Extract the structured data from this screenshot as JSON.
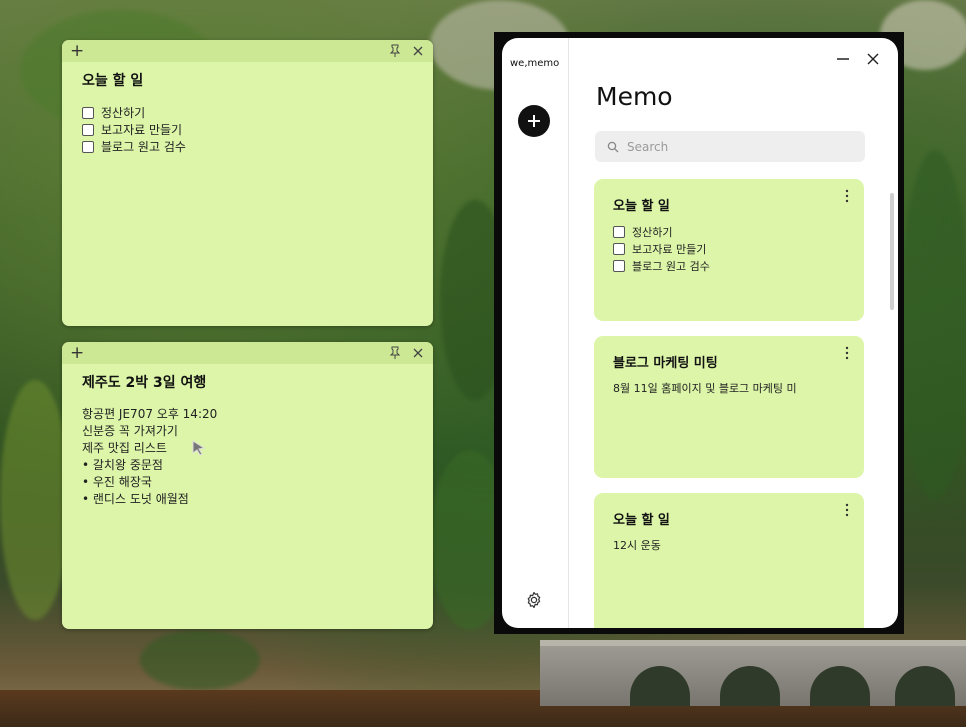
{
  "sticky_notes": [
    {
      "title": "오늘 할 일",
      "items": [
        "정산하기",
        "보고자료 만들기",
        "블로그 원고 검수"
      ]
    },
    {
      "title": "제주도 2박 3일 여행",
      "lines": [
        "항공편 JE707 오후 14:20",
        "신분증 꼭 가져가기",
        "제주 맛집 리스트",
        "• 갈치왕 중문점",
        "• 우진 해장국",
        "• 랜디스 도넛 애월점"
      ]
    }
  ],
  "app": {
    "brand": "we,memo",
    "title": "Memo",
    "search": {
      "placeholder": "Search"
    },
    "cards": [
      {
        "title": "오늘 할 일",
        "items": [
          "정산하기",
          "보고자료 만들기",
          "블로그 원고 검수"
        ]
      },
      {
        "title": "블로그 마케팅 미팅",
        "text": "8월 11일 홈페이지 및 블로그 마케팅 미"
      },
      {
        "title": "오늘 할 일",
        "text": "12시 운동"
      }
    ]
  },
  "colors": {
    "note_bg": "#dcf5a8",
    "note_bar": "#cde894",
    "accent": "#111111"
  }
}
